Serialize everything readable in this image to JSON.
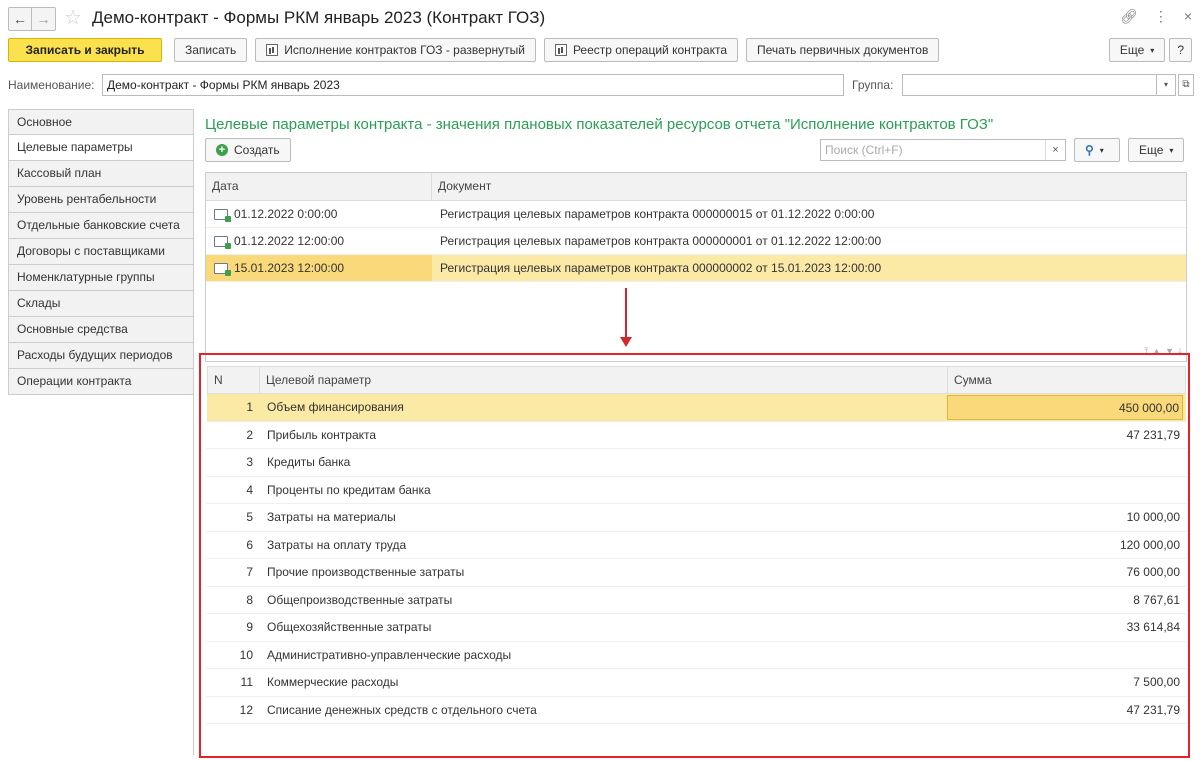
{
  "window": {
    "title": "Демо-контракт - Формы РКМ январь 2023 (Контракт ГОЗ)"
  },
  "toolbar": {
    "save_close": "Записать и закрыть",
    "save": "Записать",
    "report_exec": "Исполнение контрактов ГОЗ - развернутый",
    "report_registry": "Реестр операций контракта",
    "print_docs": "Печать первичных документов",
    "more": "Еще",
    "help": "?"
  },
  "form": {
    "name_label": "Наименование:",
    "name_value": "Демо-контракт - Формы РКМ январь 2023",
    "group_label": "Группа:",
    "group_value": ""
  },
  "tabs": [
    {
      "label": "Основное"
    },
    {
      "label": "Целевые параметры"
    },
    {
      "label": "Кассовый план"
    },
    {
      "label": "Уровень рентабельности"
    },
    {
      "label": "Отдельные банковские счета"
    },
    {
      "label": "Договоры с поставщиками"
    },
    {
      "label": "Номенклатурные группы"
    },
    {
      "label": "Склады"
    },
    {
      "label": "Основные средства"
    },
    {
      "label": "Расходы будущих периодов"
    },
    {
      "label": "Операции контракта"
    }
  ],
  "active_tab": "Целевые параметры",
  "section": {
    "heading": "Целевые параметры контракта - значения плановых показателей ресурсов отчета \"Исполнение контрактов ГОЗ\"",
    "create": "Создать",
    "search_placeholder": "Поиск (Ctrl+F)",
    "more": "Еще"
  },
  "upper_table": {
    "columns": [
      "Дата",
      "Документ"
    ],
    "rows": [
      {
        "date": "01.12.2022 0:00:00",
        "doc": "Регистрация целевых параметров контракта 000000015 от 01.12.2022 0:00:00"
      },
      {
        "date": "01.12.2022 12:00:00",
        "doc": "Регистрация целевых параметров контракта 000000001 от 01.12.2022 12:00:00"
      },
      {
        "date": "15.01.2023 12:00:00",
        "doc": "Регистрация целевых параметров контракта 000000002 от 15.01.2023 12:00:00"
      }
    ],
    "selected_index": 2
  },
  "lower_table": {
    "columns": [
      "N",
      "Целевой параметр",
      "Сумма"
    ],
    "rows": [
      {
        "n": "1",
        "param": "Объем финансирования",
        "sum": "450 000,00"
      },
      {
        "n": "2",
        "param": "Прибыль контракта",
        "sum": "47 231,79"
      },
      {
        "n": "3",
        "param": "Кредиты банка",
        "sum": ""
      },
      {
        "n": "4",
        "param": "Проценты по кредитам банка",
        "sum": ""
      },
      {
        "n": "5",
        "param": "Затраты на материалы",
        "sum": "10 000,00"
      },
      {
        "n": "6",
        "param": "Затраты на оплату труда",
        "sum": "120 000,00"
      },
      {
        "n": "7",
        "param": "Прочие производственные затраты",
        "sum": "76 000,00"
      },
      {
        "n": "8",
        "param": "Общепроизводственные затраты",
        "sum": "8 767,61"
      },
      {
        "n": "9",
        "param": "Общехозяйственные затраты",
        "sum": "33 614,84"
      },
      {
        "n": "10",
        "param": "Административно-управленческие расходы",
        "sum": ""
      },
      {
        "n": "11",
        "param": "Коммерческие расходы",
        "sum": "7 500,00"
      },
      {
        "n": "12",
        "param": "Списание денежных средств с отдельного счета",
        "sum": "47 231,79"
      }
    ],
    "selected_index": 0
  }
}
